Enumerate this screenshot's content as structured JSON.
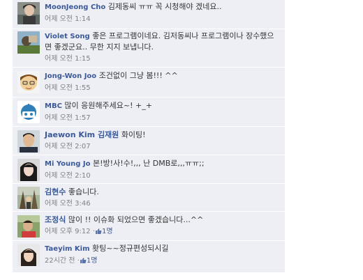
{
  "comments": [
    {
      "name": "MoonJeong Cho",
      "text": "김제동씨 ㅠㅠ 꼭 시청해야 겠네요..",
      "time": "어제 오전 1:14"
    },
    {
      "name": "Violet Song",
      "text": "좋은 프로그램이네요. 김저동씨나 프로그램이나 장수했으면 좋겠군요.. 무한 지지 보냅니다.",
      "time": "어제 오전 1:15"
    },
    {
      "name": "Jong-Won Joo",
      "text": "조건없이 그냥 봄!!! ^^",
      "time": "어제 오전 1:55"
    },
    {
      "name": "MBC",
      "text": "많이 응원해주세요~! +_+",
      "time": "어제 오전 1:57"
    },
    {
      "name": "Jaewon Kim 김재원",
      "text": "화이팅!",
      "time": "어제 오전 2:07"
    },
    {
      "name": "Mi Young Jo",
      "text": "본!방!사!수!,,, 난 DMB로,,,ㅠㅠ;;",
      "time": "어제 오전 2:10"
    },
    {
      "name": "김현수",
      "text": "좋습니다.",
      "time": "어제 오전 3:46"
    },
    {
      "name": "조정식",
      "text": "많이 !! 이슈화 되었으면 좋겠습니다...^^",
      "time": "어제 오후 9:12",
      "separator": "·",
      "likes": "1명"
    },
    {
      "name": "Taeyim Kim",
      "text": "홧팅~~정규편성되시길",
      "time": "22시간 전",
      "separator": "·",
      "likes": "1명"
    }
  ],
  "colors": {
    "name": "#3b5998",
    "bg": "#edeff4",
    "meta": "#808080"
  },
  "icons": [
    "thumbs-up-icon"
  ]
}
